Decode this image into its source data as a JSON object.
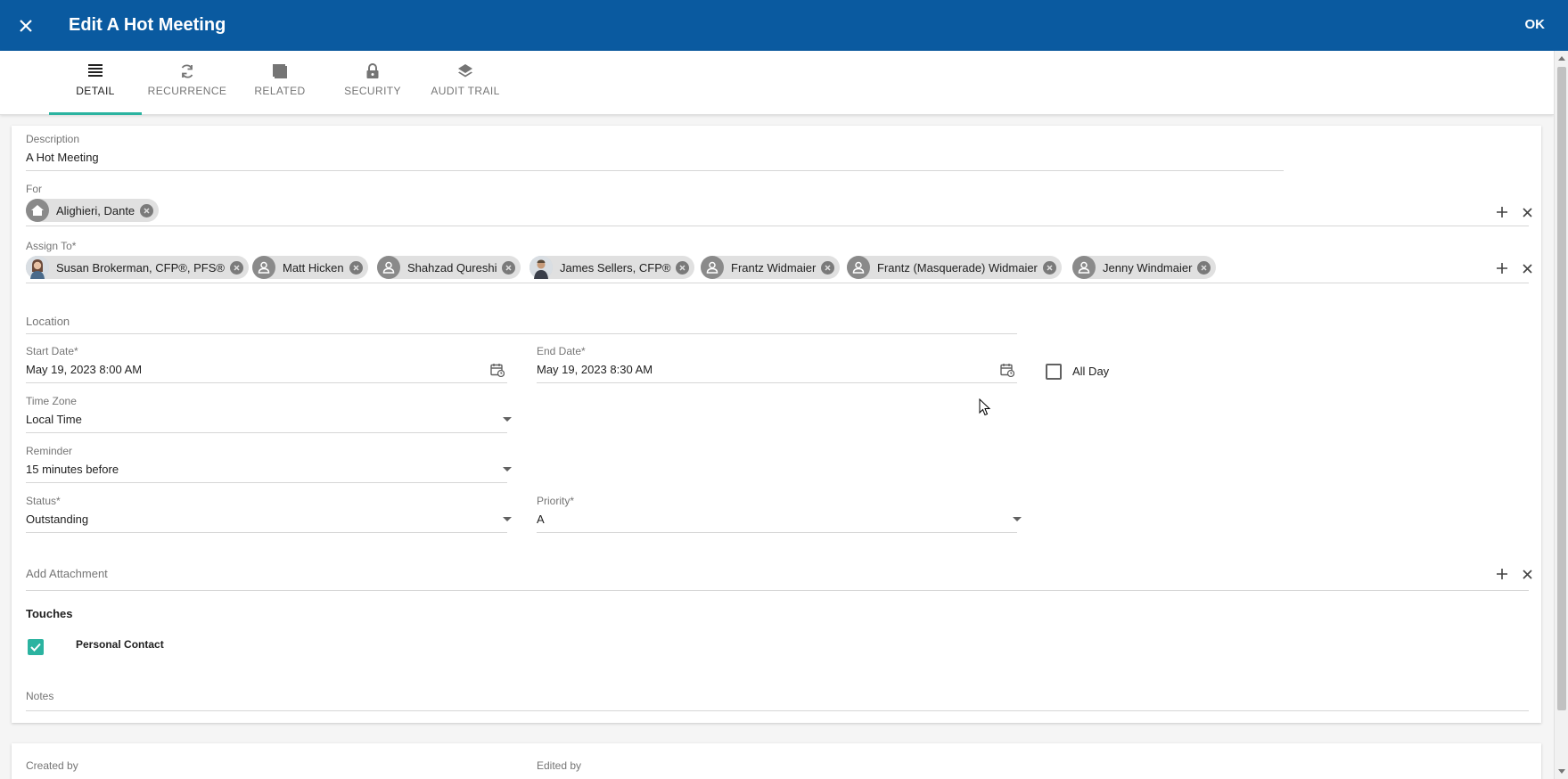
{
  "header": {
    "title": "Edit A Hot Meeting",
    "ok_label": "OK"
  },
  "tabs": [
    {
      "label": "DETAIL",
      "icon": "list-icon",
      "active": true
    },
    {
      "label": "RECURRENCE",
      "icon": "refresh-icon",
      "active": false
    },
    {
      "label": "RELATED",
      "icon": "related-icon",
      "active": false
    },
    {
      "label": "SECURITY",
      "icon": "lock-icon",
      "active": false
    },
    {
      "label": "AUDIT TRAIL",
      "icon": "layers-icon",
      "active": false
    }
  ],
  "form": {
    "description": {
      "label": "Description",
      "value": "A Hot Meeting"
    },
    "for": {
      "label": "For",
      "chips": [
        {
          "name": "Alighieri, Dante",
          "avatar": "home-icon"
        }
      ]
    },
    "assign_to": {
      "label": "Assign To*",
      "chips": [
        {
          "name": "Susan Brokerman, CFP®, PFS®",
          "avatar": "photo"
        },
        {
          "name": "Matt Hicken",
          "avatar": "person-icon"
        },
        {
          "name": "Shahzad Qureshi",
          "avatar": "person-icon"
        },
        {
          "name": "James Sellers, CFP®",
          "avatar": "photo"
        },
        {
          "name": "Frantz Widmaier",
          "avatar": "person-icon"
        },
        {
          "name": "Frantz (Masquerade) Widmaier",
          "avatar": "person-icon"
        },
        {
          "name": "Jenny Windmaier",
          "avatar": "person-icon"
        }
      ]
    },
    "location": {
      "label": "Location",
      "value": ""
    },
    "start_date": {
      "label": "Start Date*",
      "value": "May 19, 2023 8:00 AM"
    },
    "end_date": {
      "label": "End Date*",
      "value": "May 19, 2023 8:30 AM"
    },
    "all_day": {
      "label": "All Day",
      "checked": false
    },
    "time_zone": {
      "label": "Time Zone",
      "value": "Local Time"
    },
    "reminder": {
      "label": "Reminder",
      "value": "15 minutes before"
    },
    "status": {
      "label": "Status*",
      "value": "Outstanding"
    },
    "priority": {
      "label": "Priority*",
      "value": "A"
    },
    "attachment": {
      "label": "Add Attachment"
    },
    "touches": {
      "title": "Touches",
      "personal_contact_label": "Personal Contact",
      "personal_contact_checked": true
    },
    "notes": {
      "label": "Notes"
    }
  },
  "footer": {
    "created_by_label": "Created by",
    "edited_by_label": "Edited by"
  },
  "colors": {
    "header_bg": "#0a5aa0",
    "accent": "#2bb3a0"
  }
}
